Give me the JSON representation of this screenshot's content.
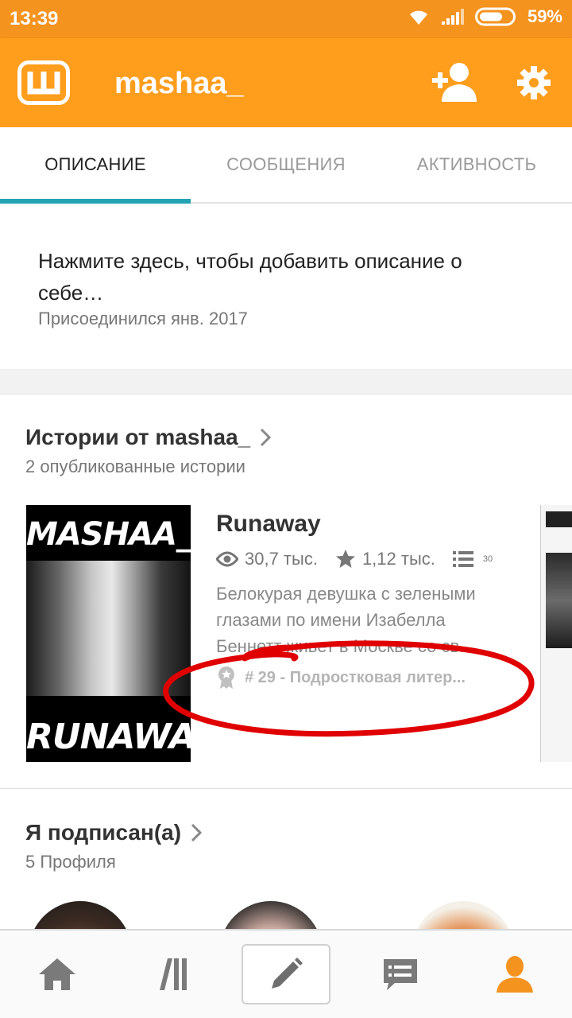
{
  "status_bar": {
    "time": "13:39",
    "battery": "59%"
  },
  "app_bar": {
    "username": "mashaa_",
    "logo_letter": "Ш"
  },
  "tabs": [
    {
      "label": "ОПИСАНИЕ",
      "active": true
    },
    {
      "label": "СООБЩЕНИЯ",
      "active": false
    },
    {
      "label": "АКТИВНОСТЬ",
      "active": false
    }
  ],
  "about": {
    "description_prompt": "Нажмите здесь, чтобы добавить описание о себе…",
    "joined": "Присоединился янв. 2017"
  },
  "stories": {
    "title": "Истории от mashaa_",
    "subtitle": "2 опубликованные истории",
    "items": [
      {
        "title": "Runaway",
        "cover_top_text": "MASHAA_",
        "cover_bottom_text": "RUNAWAY",
        "views": "30,7 тыс.",
        "votes": "1,12 тыс.",
        "parts": "30",
        "description": "Белокурая девушка с зелеными глазами по имени Изабелла Беннетт живет в Москве со св...",
        "rank": "# 29 - Подростковая литер..."
      }
    ]
  },
  "following": {
    "title": "Я подписан(а)",
    "subtitle": "5 Профиля"
  },
  "colors": {
    "status_bar": "#f5931f",
    "app_bar": "#ff9d1c",
    "tab_indicator": "#23a3b3",
    "annotation_red": "#e00000",
    "active_nav": "#f5931f"
  },
  "bottom_nav": [
    {
      "icon": "home-icon"
    },
    {
      "icon": "library-icon"
    },
    {
      "icon": "pencil-icon"
    },
    {
      "icon": "messages-icon"
    },
    {
      "icon": "profile-icon"
    }
  ]
}
